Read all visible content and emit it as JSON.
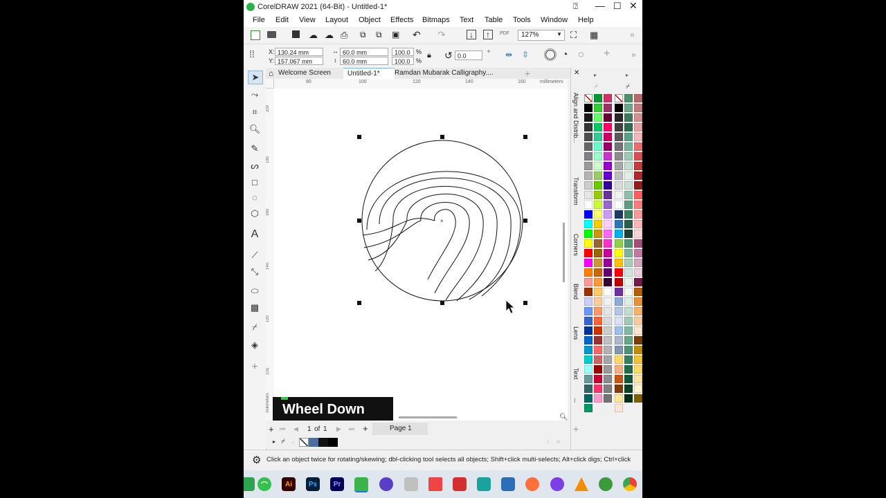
{
  "window": {
    "title": "CorelDRAW 2021 (64-Bit) - Untitled-1*"
  },
  "menu": [
    "File",
    "Edit",
    "View",
    "Layout",
    "Object",
    "Effects",
    "Bitmaps",
    "Text",
    "Table",
    "Tools",
    "Window",
    "Help"
  ],
  "toolbar": {
    "zoom": "127%",
    "pdf_label": "PDF"
  },
  "properties": {
    "x_label": "X:",
    "x_value": "130.24 mm",
    "y_label": "Y:",
    "y_value": "157.067 mm",
    "width_value": "60.0 mm",
    "height_value": "60.0 mm",
    "scale_x": "100.0",
    "scale_y": "100.0",
    "pct": "%",
    "rotation": "0.0"
  },
  "doc_tabs": [
    "Welcome Screen",
    "Untitled-1*",
    "Ramdan Mubarak Calligraphy...."
  ],
  "ruler_top": [
    "80",
    "100",
    "120",
    "140",
    "160",
    "millimeters"
  ],
  "ruler_left": [
    "200",
    "180",
    "160",
    "140",
    "120",
    "100",
    "millimeters"
  ],
  "dockers": [
    "Align and Distrib...",
    "Transform",
    "Corners",
    "Blend",
    "Lens",
    "Text"
  ],
  "page_nav": {
    "current": "1",
    "of_label": "of",
    "total": "1",
    "page_tab": "Page 1"
  },
  "status": {
    "hint": "Click an object twice for rotating/skewing; dbl-clicking tool selects all objects; Shift+click multi-selects; Alt+click digs; Ctrl+click"
  },
  "overlay": {
    "text": "Wheel Down"
  },
  "taskbar_apps": [
    {
      "name": "Ai",
      "color": "#330000",
      "fg": "#ff9a00"
    },
    {
      "name": "Ps",
      "color": "#001e36",
      "fg": "#31a8ff"
    },
    {
      "name": "Pr",
      "color": "#00005b",
      "fg": "#9999ff"
    }
  ],
  "palette_colors": {
    "col1": [
      "#000000",
      "#1a1a1a",
      "#333333",
      "#4d4d4d",
      "#666666",
      "#808080",
      "#999999",
      "#b3b3b3",
      "#cccccc",
      "#e6e6e6",
      "#ffffff",
      "#0000ff",
      "#00ffff",
      "#00ff00",
      "#ffff00",
      "#ff0000",
      "#ff00ff",
      "#ff8000",
      "#ff9999",
      "#993300",
      "#ccccff",
      "#6699ff",
      "#3366cc",
      "#003399",
      "#0066cc",
      "#0099cc",
      "#00cccc",
      "#99ffff",
      "#669999",
      "#336666",
      "#006666",
      "#009966"
    ],
    "col2": [
      "#009933",
      "#33cc33",
      "#66ff66",
      "#00cc66",
      "#33cc99",
      "#66ffcc",
      "#99ffcc",
      "#ccffcc",
      "#99cc66",
      "#66cc00",
      "#99cc00",
      "#ccff33",
      "#ffff66",
      "#ffcc00",
      "#cc9900",
      "#996633",
      "#996600",
      "#cc9933",
      "#cc6600",
      "#ff9933",
      "#ffcc66",
      "#ffcc99",
      "#ff9966",
      "#ff6633",
      "#cc3300",
      "#993333",
      "#ff6666",
      "#cc6666",
      "#990000",
      "#cc0033",
      "#ff3366",
      "#ff99cc"
    ],
    "col3": [
      "#cc3366",
      "#993366",
      "#660033",
      "#ff0066",
      "#cc0066",
      "#990066",
      "#cc33cc",
      "#9900cc",
      "#6600cc",
      "#330099",
      "#663399",
      "#9966cc",
      "#cc99ff",
      "#ffccff",
      "#ff66ff",
      "#ff33cc",
      "#cc0099",
      "#990099",
      "#660066",
      "#330033",
      "#ffffff",
      "#f2f2f2",
      "#e5e5e5",
      "#d9d9d9",
      "#cccccc",
      "#bfbfbf",
      "#b2b2b2",
      "#a5a5a5",
      "#999999",
      "#8c8c8c",
      "#7f7f7f",
      "#727272"
    ],
    "col4": [
      "#000000",
      "#262626",
      "#404040",
      "#595959",
      "#737373",
      "#8c8c8c",
      "#a6a6a6",
      "#bfbfbf",
      "#d9d9d9",
      "#f2f2f2",
      "#ffffff",
      "#1f3864",
      "#2e75b6",
      "#00b0f0",
      "#92d050",
      "#ffff00",
      "#ffc000",
      "#ff0000",
      "#c00000",
      "#7030a0",
      "#8ea9db",
      "#b4c6e7",
      "#d9e1f2",
      "#9bc2e6",
      "#acb9ca",
      "#8497b0",
      "#ffd966",
      "#f4b084",
      "#c65911",
      "#833c0b",
      "#ffe699",
      "#fce4d6"
    ],
    "col5": [
      "#4e8f6b",
      "#6aa68a",
      "#3d7a5e",
      "#2f6b4f",
      "#5aa18a",
      "#76b59c",
      "#9cc9b4",
      "#bfdccf",
      "#e2efe9",
      "#c9e0d4",
      "#8fbfa8",
      "#5e9c80",
      "#3b7d61",
      "#2b5e48",
      "#1d4031",
      "#4f9a78",
      "#7fb49a",
      "#a7cdb9",
      "#d0e6da",
      "#e8f3ed",
      "#f4f9f6",
      "#dfeee6",
      "#c1ddcf",
      "#a2cbb7",
      "#84b9a0",
      "#66a789",
      "#4b9473",
      "#35805f",
      "#236b4c",
      "#145738",
      "#0a4326",
      "#033016"
    ],
    "col6": [
      "#b46b6b",
      "#c47c7c",
      "#d48f8f",
      "#e4a3a3",
      "#f0b8b8",
      "#e96d6d",
      "#d94f4f",
      "#c43b3b",
      "#aa2b2b",
      "#8e1f1f",
      "#ff5e5e",
      "#ff7b7b",
      "#ff9999",
      "#ffb6b6",
      "#ffd3d3",
      "#a64d79",
      "#c27ba0",
      "#d5a6bd",
      "#ead1dc",
      "#741b47",
      "#b45f06",
      "#e69138",
      "#f6b26b",
      "#f9cb9c",
      "#fce5cd",
      "#783f04",
      "#bf9000",
      "#f1c232",
      "#ffd966",
      "#ffe599",
      "#fff2cc",
      "#7f6000"
    ]
  }
}
